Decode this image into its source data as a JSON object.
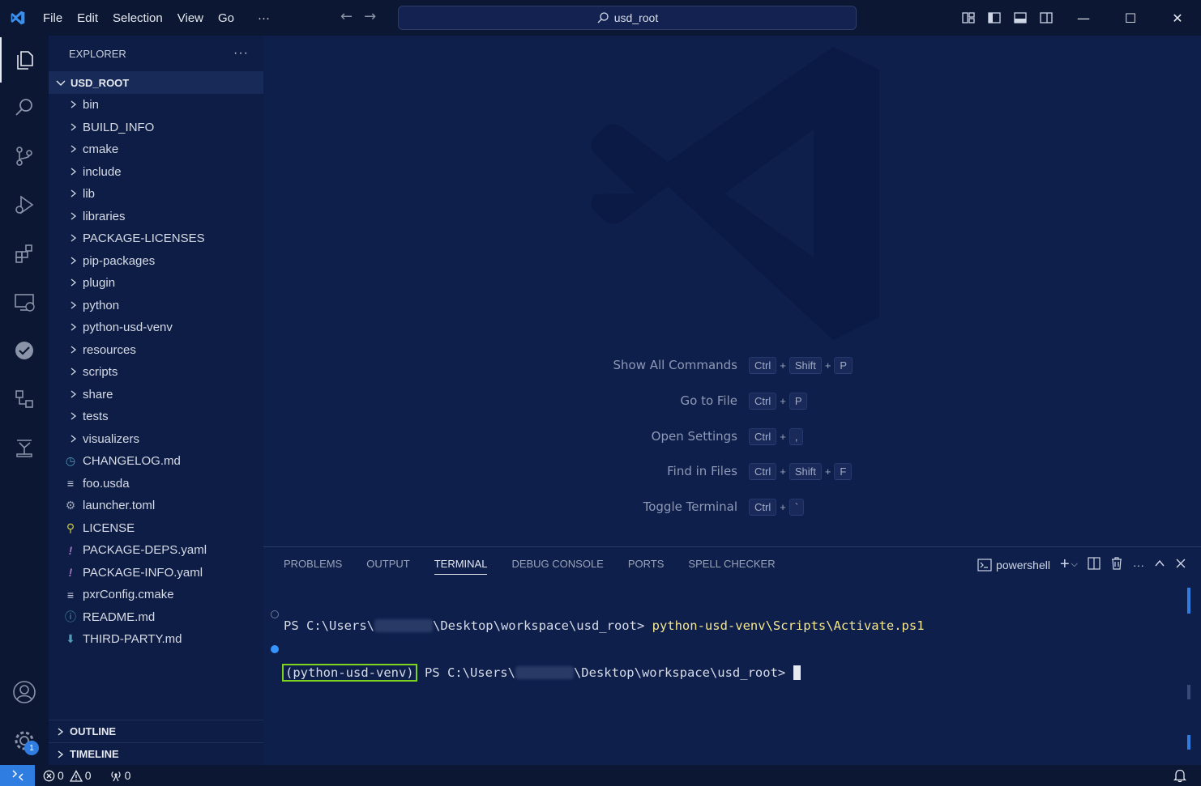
{
  "titlebar": {
    "menu": [
      "File",
      "Edit",
      "Selection",
      "View",
      "Go",
      "···"
    ],
    "search_text": "usd_root"
  },
  "sidebar": {
    "title": "EXPLORER",
    "more": "···",
    "root": "USD_ROOT",
    "folders": [
      "bin",
      "BUILD_INFO",
      "cmake",
      "include",
      "lib",
      "libraries",
      "PACKAGE-LICENSES",
      "pip-packages",
      "plugin",
      "python",
      "python-usd-venv",
      "resources",
      "scripts",
      "share",
      "tests",
      "visualizers"
    ],
    "files": [
      {
        "name": "CHANGELOG.md",
        "icon": "clock-icon",
        "color": "#519aba"
      },
      {
        "name": "foo.usda",
        "icon": "lines-icon",
        "color": "#cfd6e6"
      },
      {
        "name": "launcher.toml",
        "icon": "gear-icon",
        "color": "#9aa3b8"
      },
      {
        "name": "LICENSE",
        "icon": "license-icon",
        "color": "#cbcb41"
      },
      {
        "name": "PACKAGE-DEPS.yaml",
        "icon": "exclamation-icon",
        "color": "#a074c4"
      },
      {
        "name": "PACKAGE-INFO.yaml",
        "icon": "exclamation-icon",
        "color": "#a074c4"
      },
      {
        "name": "pxrConfig.cmake",
        "icon": "lines-icon",
        "color": "#cfd6e6"
      },
      {
        "name": "README.md",
        "icon": "info-icon",
        "color": "#519aba"
      },
      {
        "name": "THIRD-PARTY.md",
        "icon": "download-icon",
        "color": "#519aba"
      }
    ],
    "outline": "OUTLINE",
    "timeline": "TIMELINE"
  },
  "activity": {
    "settings_badge": "1"
  },
  "shortcuts": [
    {
      "label": "Show All Commands",
      "keys": [
        "Ctrl",
        "Shift",
        "P"
      ]
    },
    {
      "label": "Go to File",
      "keys": [
        "Ctrl",
        "P"
      ]
    },
    {
      "label": "Open Settings",
      "keys": [
        "Ctrl",
        ","
      ]
    },
    {
      "label": "Find in Files",
      "keys": [
        "Ctrl",
        "Shift",
        "F"
      ]
    },
    {
      "label": "Toggle Terminal",
      "keys": [
        "Ctrl",
        "`"
      ]
    }
  ],
  "panel": {
    "tabs": [
      "PROBLEMS",
      "OUTPUT",
      "TERMINAL",
      "DEBUG CONSOLE",
      "PORTS",
      "SPELL CHECKER"
    ],
    "active_tab": "TERMINAL",
    "shell": "powershell",
    "more": "···"
  },
  "terminal": {
    "line1_prefix": "PS C:\\Users\\",
    "line1_path": "\\Desktop\\workspace\\usd_root> ",
    "line1_cmd": "python-usd-venv\\Scripts\\Activate.ps1",
    "line2_venv": "(python-usd-venv)",
    "line2_prefix": " PS C:\\Users\\",
    "line2_path": "\\Desktop\\workspace\\usd_root> "
  },
  "status": {
    "errors": "0",
    "warnings": "0",
    "ports": "0"
  },
  "colors": {
    "accent": "#2f7de1",
    "highlight_box": "#7ed321",
    "command": "#f4e68c"
  }
}
